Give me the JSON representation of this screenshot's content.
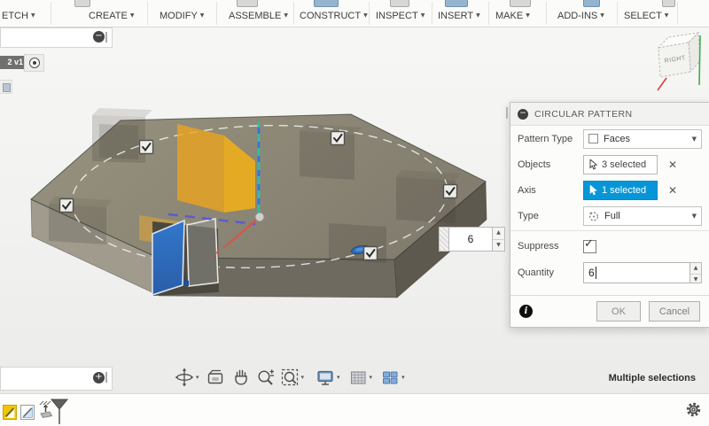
{
  "toolbar": {
    "menus": [
      "ETCH",
      "CREATE",
      "MODIFY",
      "ASSEMBLE",
      "CONSTRUCT",
      "INSPECT",
      "INSERT",
      "MAKE",
      "ADD-INS",
      "SELECT"
    ]
  },
  "browser": {
    "document_label": "2 v1"
  },
  "canvas": {
    "quantity_spinner": "6",
    "viewcube_face": "RIGHT",
    "pattern_instances_checked": true
  },
  "dialog": {
    "title": "CIRCULAR PATTERN",
    "pattern_type": {
      "label": "Pattern Type",
      "value": "Faces"
    },
    "objects": {
      "label": "Objects",
      "value": "3 selected"
    },
    "axis": {
      "label": "Axis",
      "value": "1 selected"
    },
    "type": {
      "label": "Type",
      "value": "Full"
    },
    "suppress": {
      "label": "Suppress",
      "checked": true
    },
    "quantity": {
      "label": "Quantity",
      "value": "6"
    },
    "ok_label": "OK",
    "cancel_label": "Cancel",
    "accent_color": "#0696d7"
  },
  "statusbar": {
    "selection_status": "Multiple selections"
  },
  "icons": {
    "caret_down": "▼",
    "caret_small": "▾",
    "close": "✕",
    "check": "✓",
    "info": "i",
    "collapse": "−",
    "expand": "+",
    "spinner_up": "▲",
    "spinner_down": "▼"
  }
}
